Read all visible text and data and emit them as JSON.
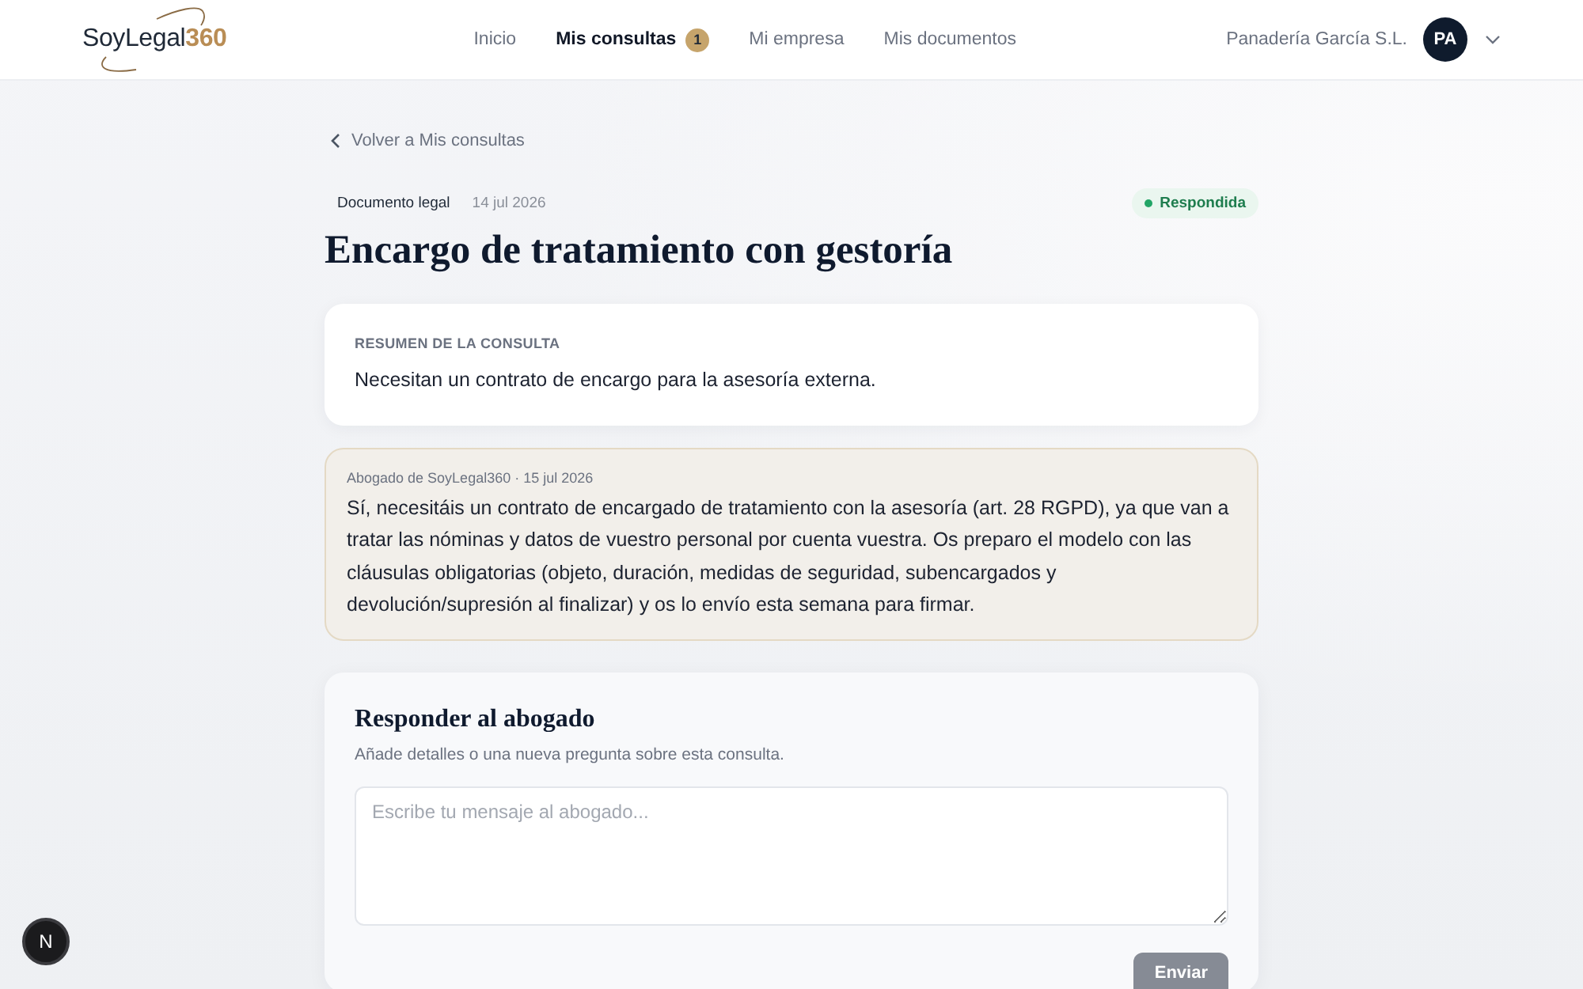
{
  "header": {
    "logo": {
      "name": "SoyLegal",
      "accent": "360"
    },
    "nav": [
      {
        "label": "Inicio",
        "selected": false
      },
      {
        "label": "Mis consultas",
        "selected": true,
        "badge": "1"
      },
      {
        "label": "Mi empresa",
        "selected": false
      },
      {
        "label": "Mis documentos",
        "selected": false
      }
    ],
    "account": {
      "company": "Panadería García S.L.",
      "initials": "PA"
    }
  },
  "back_link": "Volver a Mis consultas",
  "consultation": {
    "category": "Documento legal",
    "date": "14 jul 2026",
    "status": {
      "label": "Respondida",
      "kind": "answered"
    },
    "title": "Encargo de tratamiento con gestoría"
  },
  "summary": {
    "heading": "RESUMEN DE LA CONSULTA",
    "text": "Necesitan un contrato de encargo para la asesoría externa."
  },
  "messages": [
    {
      "kind": "lawyer",
      "meta": "Abogado de SoyLegal360 · 15 jul 2026",
      "text": "Sí, necesitáis un contrato de encargado de tratamiento con la asesoría (art. 28 RGPD), ya que van a tratar las nóminas y datos de vuestro personal por cuenta vuestra. Os preparo el modelo con las cláusulas obligatorias (objeto, duración, medidas de seguridad, subencargados y devolución/supresión al finalizar) y os lo envío esta semana para firmar."
    }
  ],
  "reply": {
    "title": "Responder al abogado",
    "subtitle": "Añade detalles o una nueva pregunta sobre esta consulta.",
    "placeholder": "Escribe tu mensaje al abogado...",
    "button": {
      "label": "Enviar",
      "disabled": true
    }
  },
  "dev_indicator": {
    "label": "N"
  }
}
